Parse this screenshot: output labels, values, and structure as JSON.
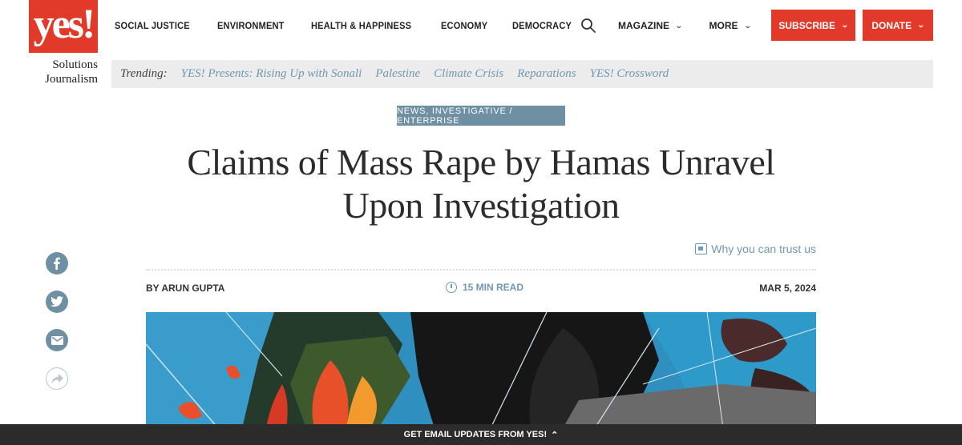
{
  "logo": {
    "mark": "yes!",
    "sub_line1": "Solutions",
    "sub_line2": "Journalism"
  },
  "nav": {
    "items": [
      "SOCIAL JUSTICE",
      "ENVIRONMENT",
      "HEALTH & HAPPINESS",
      "ECONOMY",
      "DEMOCRACY"
    ],
    "magazine": "MAGAZINE",
    "more": "MORE",
    "subscribe": "SUBSCRIBE",
    "donate": "DONATE"
  },
  "trending": {
    "label": "Trending:",
    "links": [
      "YES! Presents: Rising Up with Sonali",
      "Palestine",
      "Climate Crisis",
      "Reparations",
      "YES! Crossword"
    ]
  },
  "article": {
    "category": "NEWS, INVESTIGATIVE / ENTERPRISE",
    "title_line1": "Claims of Mass Rape by Hamas Unravel",
    "title_line2": "Upon Investigation",
    "trust_link": "Why you can trust us",
    "author": "BY ARUN GUPTA",
    "read_time": "15 MIN READ",
    "date": "MAR 5, 2024"
  },
  "social": [
    "facebook-icon",
    "twitter-icon",
    "email-icon",
    "share-icon"
  ],
  "footer_bar": {
    "label": "GET EMAIL UPDATES FROM YES!"
  },
  "colors": {
    "brand_red": "#e23a2a",
    "link_blue": "#6f98b2",
    "tag_bg": "#6f8fa3"
  }
}
